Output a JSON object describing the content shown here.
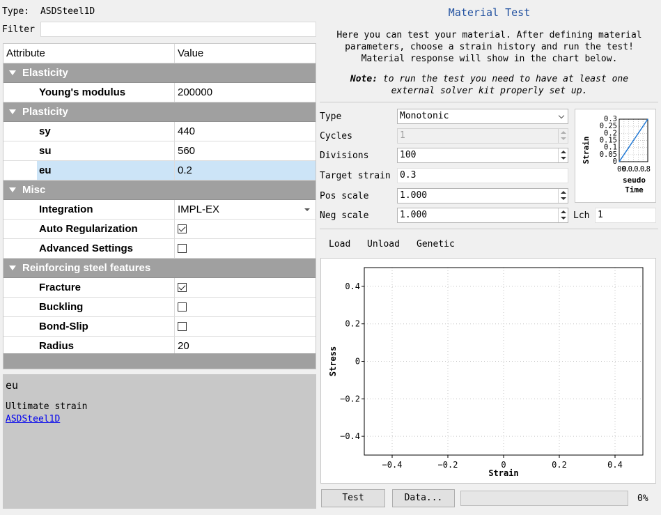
{
  "left": {
    "type_label": "Type:",
    "type_value": "ASDSteel1D",
    "filter_label": "Filter",
    "filter_value": "",
    "columns": {
      "attribute": "Attribute",
      "value": "Value"
    },
    "groups": {
      "elasticity": "Elasticity",
      "plasticity": "Plasticity",
      "misc": "Misc",
      "reinforcing": "Reinforcing steel features"
    },
    "props": {
      "youngs_modulus": {
        "label": "Young's modulus",
        "value": "200000"
      },
      "sy": {
        "label": "sy",
        "value": "440"
      },
      "su": {
        "label": "su",
        "value": "560"
      },
      "eu": {
        "label": "eu",
        "value": "0.2"
      },
      "integration": {
        "label": "Integration",
        "value": "IMPL-EX"
      },
      "auto_reg": {
        "label": "Auto Regularization",
        "checked": true
      },
      "advanced": {
        "label": "Advanced Settings",
        "checked": false
      },
      "fracture": {
        "label": "Fracture",
        "checked": true
      },
      "buckling": {
        "label": "Buckling",
        "checked": false
      },
      "bond_slip": {
        "label": "Bond-Slip",
        "checked": false
      },
      "radius": {
        "label": "Radius",
        "value": "20"
      }
    },
    "description": {
      "title": "eu",
      "text": "Ultimate strain",
      "link": "ASDSteel1D"
    }
  },
  "right": {
    "title": "Material Test",
    "intro_1": "Here you can test your material. After defining material",
    "intro_2": "parameters, choose a strain history and run the test!",
    "intro_3": "Material response will show in the chart below.",
    "note_label": "Note:",
    "note_1": "to run the test you need to have at least one",
    "note_2": "external solver kit properly set up.",
    "form": {
      "type_label": "Type",
      "type_value": "Monotonic",
      "cycles_label": "Cycles",
      "cycles_value": "1",
      "divisions_label": "Divisions",
      "divisions_value": "100",
      "target_label": "Target strain",
      "target_value": "0.3",
      "pos_label": "Pos scale",
      "pos_value": "1.000",
      "neg_label": "Neg scale",
      "neg_value": "1.000",
      "lch_label": "Lch",
      "lch_value": "1"
    },
    "tabs": [
      "Load",
      "Unload",
      "Genetic"
    ],
    "buttons": {
      "test": "Test",
      "data": "Data..."
    },
    "progress": {
      "value": 0,
      "label": "0%"
    }
  },
  "chart_data": [
    {
      "type": "line",
      "xlabel": "seudo\nTime",
      "ylabel": "Strain",
      "x_tick_labels_text": "00",
      "x_tick_labels_overlap": "0.0.0.0.8",
      "y_ticks": [
        0,
        0.05,
        0.1,
        0.15,
        0.2,
        0.25,
        0.3
      ],
      "y_tick_labels": [
        "0",
        "0.05",
        "0.1",
        "0.15",
        "0.2",
        "0.25",
        "0.3"
      ],
      "x": [
        0,
        1
      ],
      "y": [
        0,
        0.3
      ],
      "xlim": [
        0,
        1
      ],
      "ylim": [
        0,
        0.3
      ],
      "grid": true,
      "line_color": "#1f77d4"
    },
    {
      "type": "line",
      "xlabel": "Strain",
      "ylabel": "Stress",
      "x_ticks": [
        -0.4,
        -0.2,
        0,
        0.2,
        0.4
      ],
      "x_tick_labels": [
        "−0.4",
        "−0.2",
        "0",
        "0.2",
        "0.4"
      ],
      "y_ticks": [
        -0.4,
        -0.2,
        0,
        0.2,
        0.4
      ],
      "y_tick_labels": [
        "−0.4",
        "−0.2",
        "0",
        "0.2",
        "0.4"
      ],
      "xlim": [
        -0.5,
        0.5
      ],
      "ylim": [
        -0.5,
        0.5
      ],
      "grid": true,
      "series": []
    }
  ]
}
